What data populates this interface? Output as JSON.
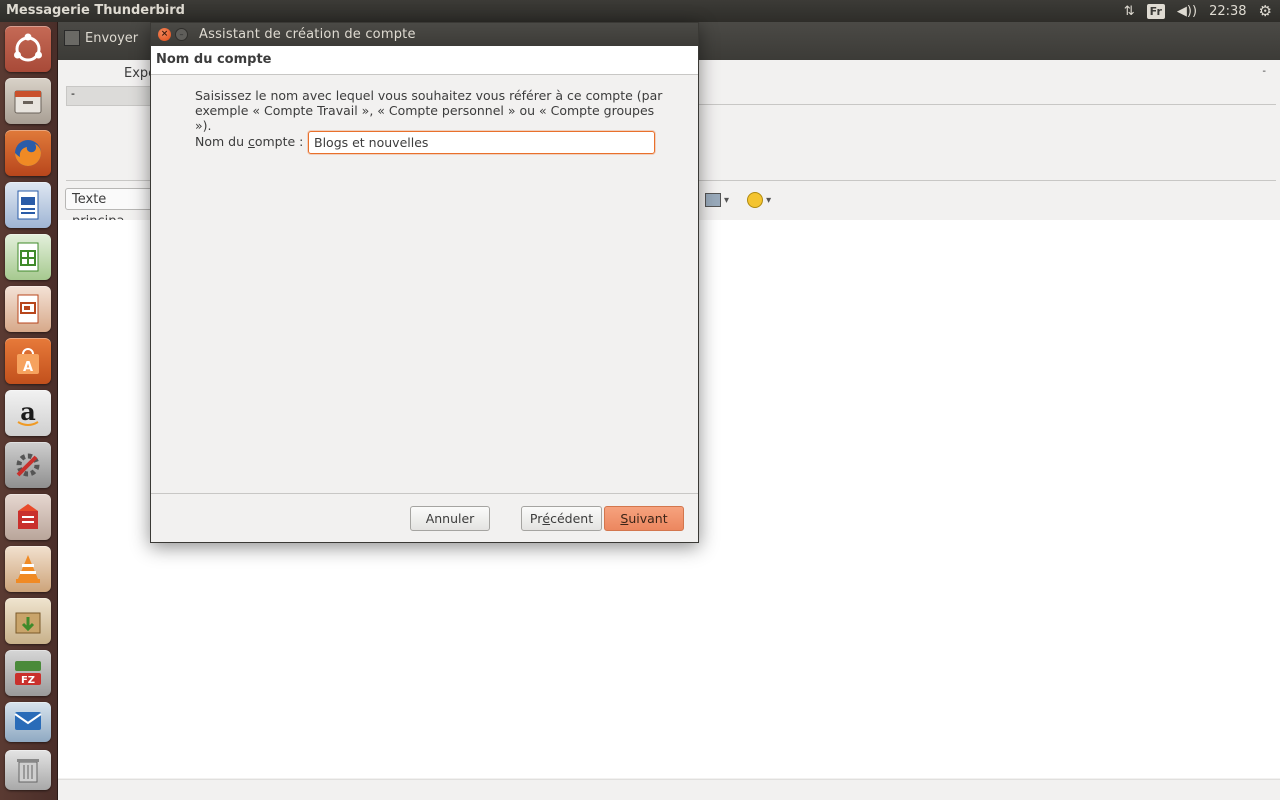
{
  "top_panel": {
    "app_title": "Messagerie Thunderbird",
    "keyboard_layout": "Fr",
    "time": "22:38",
    "icons": [
      "network-arrows-icon",
      "volume-icon",
      "settings-gear-icon"
    ]
  },
  "launcher": {
    "items": [
      {
        "name": "ubuntu-dash-icon"
      },
      {
        "name": "files-icon"
      },
      {
        "name": "firefox-icon"
      },
      {
        "name": "libreoffice-writer-icon"
      },
      {
        "name": "libreoffice-calc-icon"
      },
      {
        "name": "libreoffice-impress-icon"
      },
      {
        "name": "software-center-icon"
      },
      {
        "name": "amazon-icon"
      },
      {
        "name": "system-settings-icon"
      },
      {
        "name": "app-red-icon"
      },
      {
        "name": "vlc-icon"
      },
      {
        "name": "archive-install-icon"
      },
      {
        "name": "filezilla-icon"
      },
      {
        "name": "thunderbird-stack-icon"
      },
      {
        "name": "trash-icon"
      }
    ]
  },
  "composer": {
    "send_label": "Envoyer",
    "from_label": "Expe",
    "from_value": "-",
    "corner_dropdown": "-",
    "format_select": "Texte principa"
  },
  "dialog": {
    "title": "Assistant de création de compte",
    "header": "Nom du compte",
    "description": "Saisissez le nom avec lequel vous souhaitez vous référer à ce compte (par exemple « Compte Travail », « Compte personnel » ou « Compte groupes »).",
    "name_label_pre": "Nom du ",
    "name_label_u": "c",
    "name_label_post": "ompte :",
    "account_name_value": "Blogs et nouvelles",
    "buttons": {
      "cancel": "Annuler",
      "back_pre": "Pr",
      "back_u": "é",
      "back_post": "cédent",
      "next_u": "S",
      "next_post": "uivant"
    }
  },
  "colors": {
    "accent_orange": "#e9702b",
    "next_button": "#f09b76",
    "titlebar_dark": "#3c3b37",
    "launcher_bg": "#4a2e29"
  }
}
